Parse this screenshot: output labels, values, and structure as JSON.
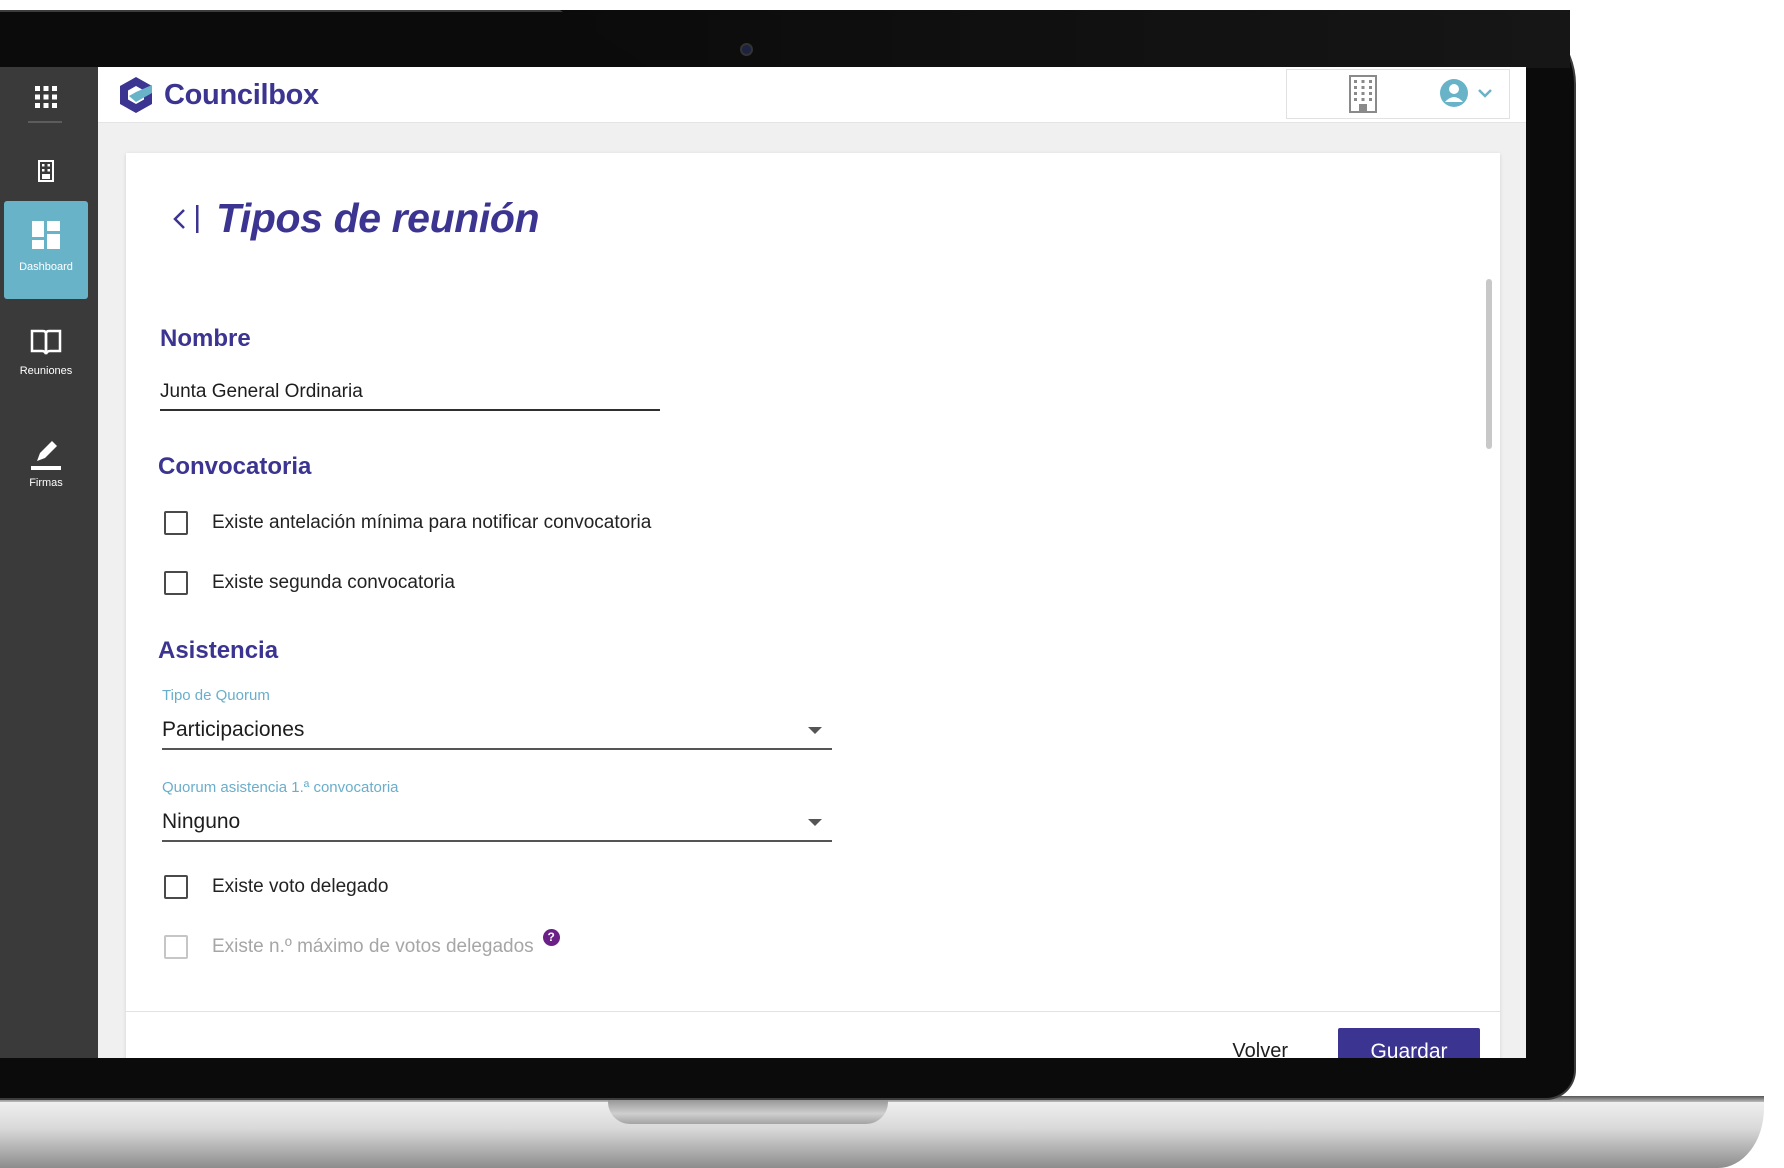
{
  "app": {
    "brand_name": "Councilbox",
    "brand_color": "#3c3491",
    "accent_color": "#69b3c9"
  },
  "sidebar": {
    "items": [
      {
        "icon": "apps-grid-icon",
        "label": ""
      },
      {
        "icon": "building-icon",
        "label": ""
      },
      {
        "icon": "dashboard-icon",
        "label": "Dashboard",
        "active": true
      },
      {
        "icon": "book-icon",
        "label": "Reuniones"
      },
      {
        "icon": "pen-icon",
        "label": "Firmas"
      }
    ]
  },
  "topbar": {
    "company_icon": "building-icon",
    "user_icon": "user-account-icon",
    "dropdown_icon": "chevron-down-icon"
  },
  "page": {
    "title": "Tipos de reunión",
    "back_icon": "back-arrow-icon"
  },
  "form": {
    "name_section": "Nombre",
    "name_value": "Junta General Ordinaria",
    "convocatoria_section": "Convocatoria",
    "convocatoria_checks": [
      {
        "label": "Existe antelación mínima para notificar convocatoria",
        "checked": false
      },
      {
        "label": "Existe segunda convocatoria",
        "checked": false
      }
    ],
    "asistencia_section": "Asistencia",
    "quorum_type": {
      "label": "Tipo de Quorum",
      "value": "Participaciones"
    },
    "quorum_first": {
      "label": "Quorum asistencia 1.ª convocatoria",
      "value": "Ninguno"
    },
    "asistencia_checks": [
      {
        "label": "Existe voto delegado",
        "checked": false,
        "disabled": false
      },
      {
        "label": "Existe n.º máximo de votos delegados",
        "checked": false,
        "disabled": true
      }
    ],
    "help_glyph": "?"
  },
  "footer": {
    "back_label": "Volver",
    "save_label": "Guardar"
  }
}
